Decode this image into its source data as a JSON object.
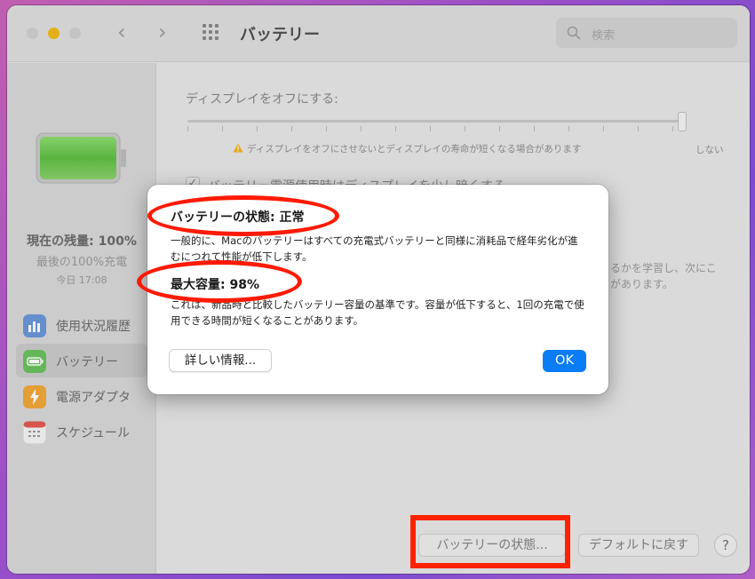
{
  "window": {
    "title": "バッテリー"
  },
  "toolbar": {
    "back_glyph": "‹",
    "forward_glyph": "›"
  },
  "search": {
    "placeholder": "検索"
  },
  "sidebar": {
    "remaining_label": "現在の残量: 100%",
    "charge_status": "最後の100%充電",
    "charge_time": "今日 17:08",
    "items": [
      {
        "label": "使用状況履歴",
        "icon": "bar-chart-icon",
        "color": "#5f8fd6"
      },
      {
        "label": "バッテリー",
        "icon": "battery-icon",
        "color": "#5fbf5a"
      },
      {
        "label": "電源アダプタ",
        "icon": "lightning-icon",
        "color": "#f0a030"
      },
      {
        "label": "スケジュール",
        "icon": "calendar-icon",
        "color": "#e05050"
      }
    ]
  },
  "content": {
    "display_off_label": "ディスプレイをオフにする:",
    "warning_text": "ディスプレイをオフにさせないとディスプレイの寿命が短くなる場合があります",
    "never_label": "しない",
    "checkbox_label": "バッテリー電源使用時はディスプレイを少し暗くする",
    "checkbox_mark": "✓",
    "learn_line_1": "るかを学習し、次にこ",
    "learn_line_2": "があります。"
  },
  "footer": {
    "battery_status_button": "バッテリーの状態...",
    "restore_defaults_button": "デフォルトに戻す",
    "help_button": "?"
  },
  "dialog": {
    "status_title": "バッテリーの状態: 正常",
    "status_desc": "一般的に、Macのバッテリーはすべての充電式バッテリーと同様に消耗品で経年劣化が進むにつれて性能が低下します。",
    "capacity_title": "最大容量: 98%",
    "capacity_desc": "これは、新品時と比較したバッテリー容量の基準です。容量が低下すると、1回の充電で使用できる時間が短くなることがあります。",
    "more_info_button": "詳しい情報...",
    "ok_button": "OK"
  },
  "colors": {
    "accent": "#0a7cf5",
    "annotation_red": "#ff1a00",
    "battery_green": "#6cc94f"
  }
}
